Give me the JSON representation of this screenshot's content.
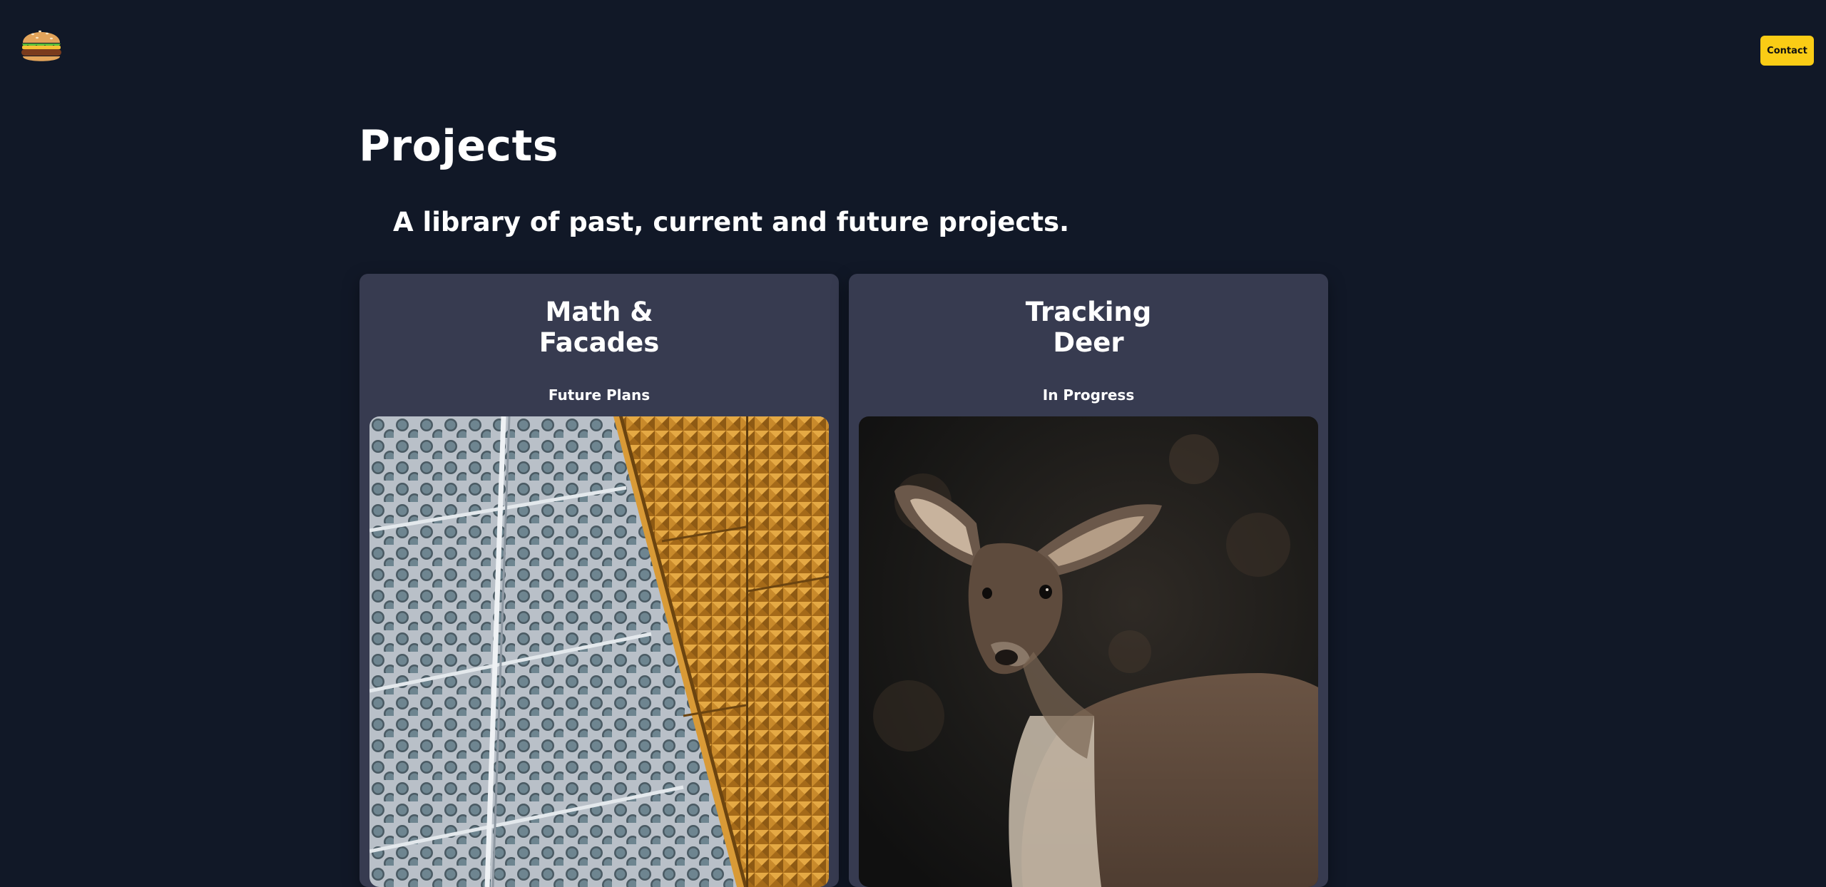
{
  "header": {
    "logo_icon": "hamburger-icon",
    "contact_label": "Contact"
  },
  "main": {
    "title": "Projects",
    "subtitle": "A library of past, current and future projects."
  },
  "projects": [
    {
      "title": "Math & Facades",
      "status": "Future Plans",
      "image_icon": "facade-photo"
    },
    {
      "title": "Tracking Deer",
      "status": "In Progress",
      "image_icon": "deer-photo"
    }
  ],
  "colors": {
    "background": "#111827",
    "card": "#373b50",
    "accent": "#facc15"
  }
}
